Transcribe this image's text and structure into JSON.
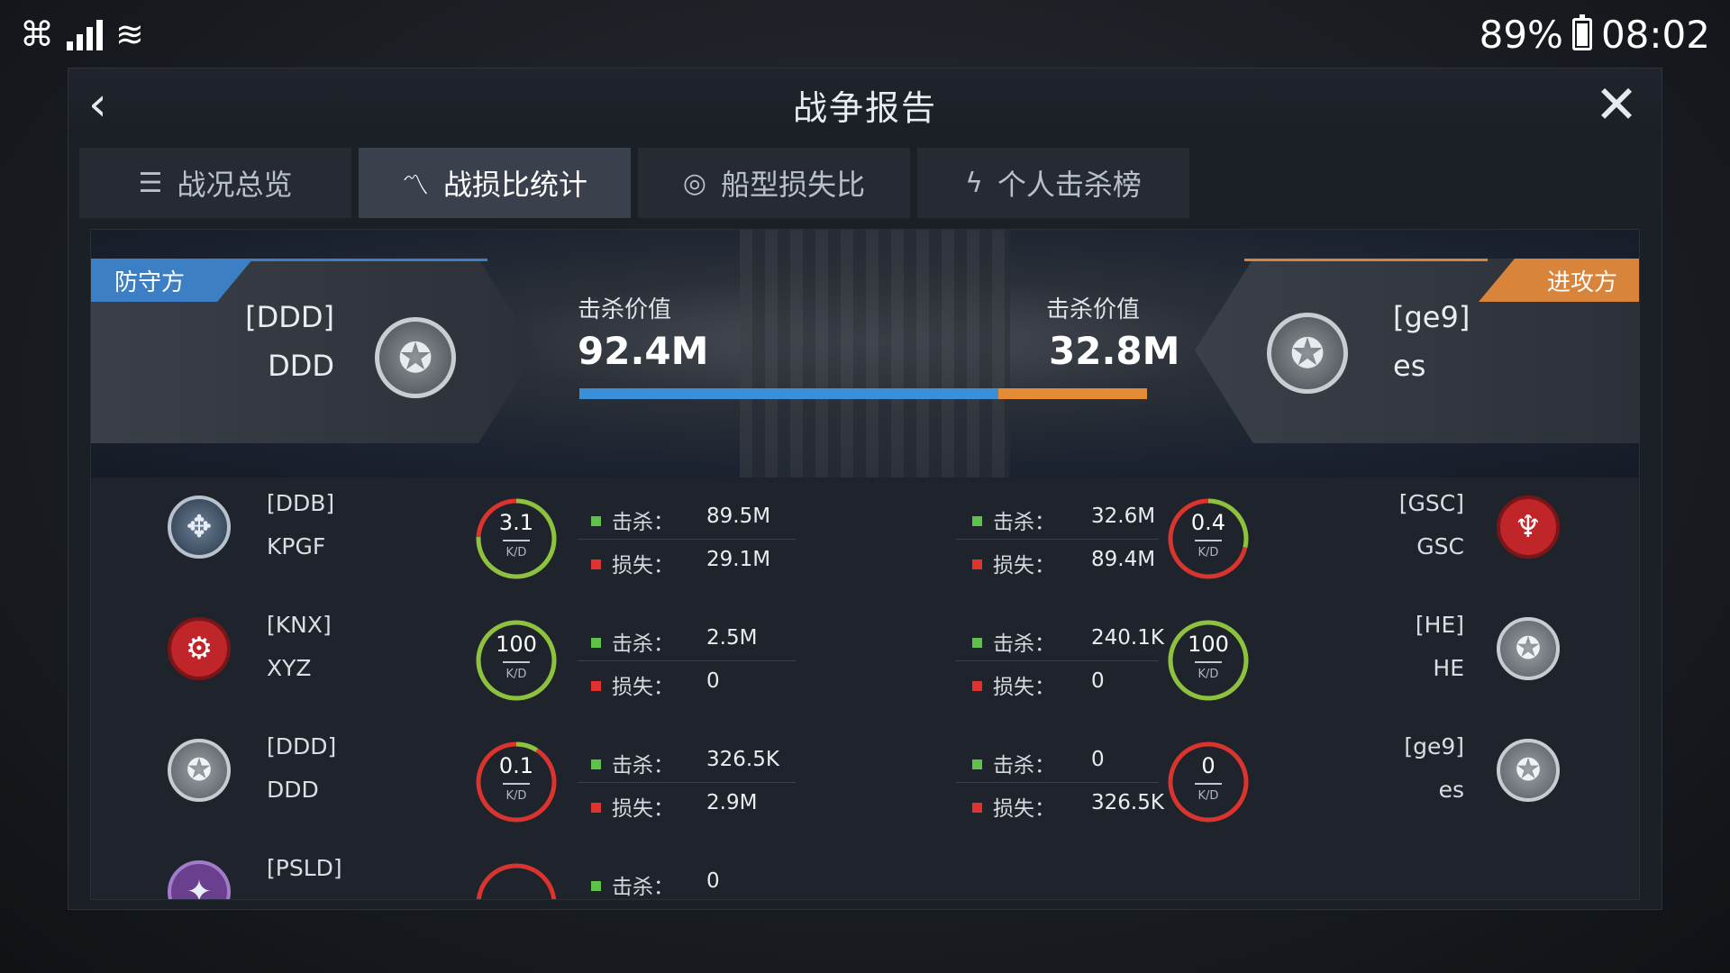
{
  "statusbar": {
    "battery": "89%",
    "time": "08:02"
  },
  "header": {
    "title": "战争报告"
  },
  "tabs": [
    {
      "label": "战况总览",
      "icon": "list-icon"
    },
    {
      "label": "战损比统计",
      "icon": "trend-icon"
    },
    {
      "label": "船型损失比",
      "icon": "ship-icon"
    },
    {
      "label": "个人击杀榜",
      "icon": "lightning-icon"
    }
  ],
  "summary": {
    "defender": {
      "role": "防守方",
      "tag": "[DDD]",
      "name": "DDD",
      "kill_label": "击杀价值",
      "kill_value": "92.4M"
    },
    "attacker": {
      "role": "进攻方",
      "tag": "[ge9]",
      "name": "es",
      "kill_label": "击杀价值",
      "kill_value": "32.8M"
    },
    "bar_defender_share": 0.738,
    "colors": {
      "defender": "#3a8fd8",
      "attacker": "#e38c35"
    }
  },
  "labels": {
    "kill": "击杀：",
    "loss": "损失：",
    "kd_unit": "K/D"
  },
  "rows": [
    {
      "left": {
        "tag": "[DDB]",
        "name": "KPGF",
        "kd": "3.1",
        "kill": "89.5M",
        "loss": "29.1M"
      },
      "right": {
        "tag": "[GSC]",
        "name": "GSC",
        "kd": "0.4",
        "kill": "32.6M",
        "loss": "89.4M"
      }
    },
    {
      "left": {
        "tag": "[KNX]",
        "name": "XYZ",
        "kd": "100",
        "kill": "2.5M",
        "loss": "0"
      },
      "right": {
        "tag": "[HE]",
        "name": "HE",
        "kd": "100",
        "kill": "240.1K",
        "loss": "0"
      }
    },
    {
      "left": {
        "tag": "[DDD]",
        "name": "DDD",
        "kd": "0.1",
        "kill": "326.5K",
        "loss": "2.9M"
      },
      "right": {
        "tag": "[ge9]",
        "name": "es",
        "kd": "0",
        "kill": "0",
        "loss": "326.5K"
      }
    },
    {
      "left": {
        "tag": "[PSLD]",
        "name": "",
        "kd": "",
        "kill": "0",
        "loss": ""
      },
      "right": null
    }
  ]
}
